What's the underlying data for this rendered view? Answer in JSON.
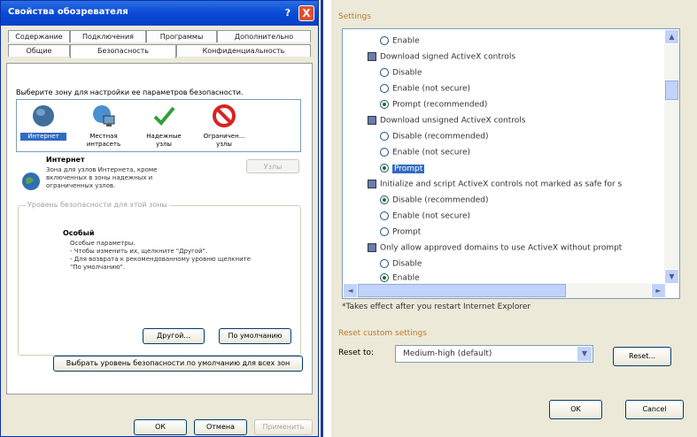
{
  "left_dialog": {
    "title": "Свойства обозревателя",
    "help": "?",
    "close": "X",
    "tabs_row1": [
      "Содержание",
      "Подключения",
      "Программы",
      "Дополнительно"
    ],
    "tabs_row2": [
      "Общие",
      "Безопасность",
      "Конфиденциальность"
    ],
    "zone_prompt": "Выберите зону для настройки ее параметров безопасности.",
    "zones": [
      "Интернет",
      "Местная интрасеть",
      "Надежные узлы",
      "Ограничен... узлы"
    ],
    "zone_title": "Интернет",
    "zone_desc": "Зона для узлов Интернета, кроме включенных в зоны надежных и ограниченных узлов.",
    "sites_button": "Узлы",
    "level_group_caption": "Уровень безопасности для этой зоны",
    "level_name": "Особый",
    "level_desc": [
      "Особые параметры.",
      "- Чтобы изменить их, щелкните \"Другой\".",
      "- Для возврата к рекомендованному уровню щелкните",
      "\"По умолчанию\"."
    ],
    "custom_button": "Другой...",
    "default_button": "По умолчанию",
    "all_zones_button": "Выбрать уровень безопасности по умолчанию для всех зон",
    "ok": "ОК",
    "cancel": "Отмена",
    "apply": "Применить"
  },
  "right_dialog": {
    "settings_label": "Settings",
    "items": [
      {
        "type": "radio",
        "label": "Enable",
        "checked": false
      },
      {
        "type": "group",
        "label": "Download signed ActiveX controls"
      },
      {
        "type": "radio",
        "label": "Disable",
        "checked": false
      },
      {
        "type": "radio",
        "label": "Enable (not secure)",
        "checked": false
      },
      {
        "type": "radio",
        "label": "Prompt (recommended)",
        "checked": true
      },
      {
        "type": "group",
        "label": "Download unsigned ActiveX controls"
      },
      {
        "type": "radio",
        "label": "Disable (recommended)",
        "checked": false
      },
      {
        "type": "radio",
        "label": "Enable (not secure)",
        "checked": false
      },
      {
        "type": "radio",
        "label": "Prompt",
        "checked": true,
        "selected": true
      },
      {
        "type": "group",
        "label": "Initialize and script ActiveX controls not marked as safe for s"
      },
      {
        "type": "radio",
        "label": "Disable (recommended)",
        "checked": true
      },
      {
        "type": "radio",
        "label": "Enable (not secure)",
        "checked": false
      },
      {
        "type": "radio",
        "label": "Prompt",
        "checked": false
      },
      {
        "type": "group",
        "label": "Only allow approved domains to use ActiveX without prompt"
      },
      {
        "type": "radio",
        "label": "Disable",
        "checked": false
      },
      {
        "type": "radio",
        "label": "Enable",
        "checked": true
      }
    ],
    "restart_note": "*Takes effect after you restart Internet Explorer",
    "reset_label": "Reset custom settings",
    "reset_to": "Reset to:",
    "reset_value": "Medium-high (default)",
    "reset_button": "Reset...",
    "ok": "OK",
    "cancel": "Cancel"
  }
}
